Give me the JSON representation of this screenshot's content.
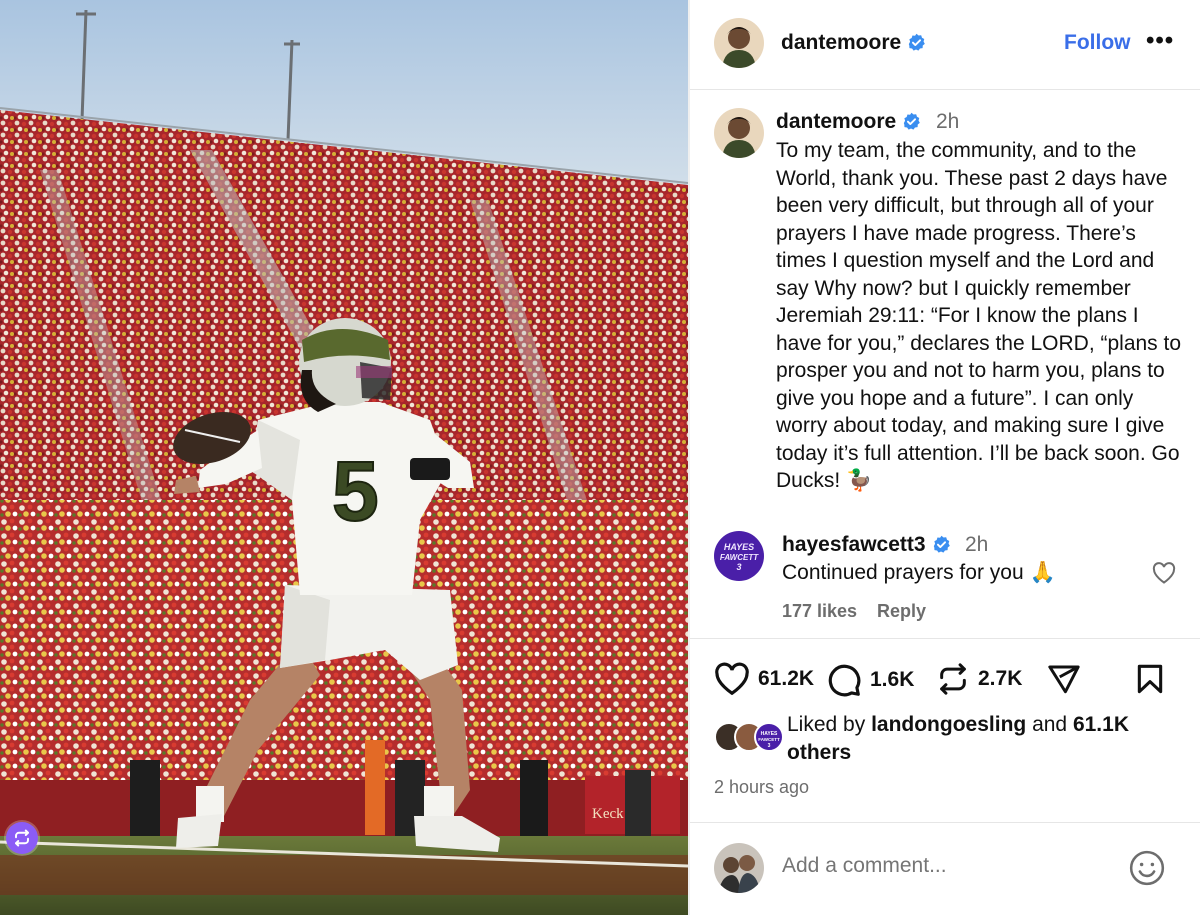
{
  "post": {
    "username": "dantemoore",
    "follow_label": "Follow",
    "more_label": "•••"
  },
  "caption": {
    "username": "dantemoore",
    "time": "2h",
    "text": "To my team, the community, and to the World, thank you. These past 2 days have been very difficult, but through all of your prayers I have made progress. There’s times I question myself and the Lord and say Why now? but I quickly remember Jeremiah 29:11: “For I know the plans I have for you,” declares the LORD, “plans to prosper you and not to harm you, plans to give you hope and a future”. I can only worry about today, and making sure I give today it’s full attention. I’ll be back soon. Go Ducks! 🦆"
  },
  "comment": {
    "username": "hayesfawcett3",
    "avatar_text": "HAYES FAWCETT 3",
    "time": "2h",
    "text": "Continued prayers for you 🙏",
    "likes": "177 likes",
    "reply_label": "Reply"
  },
  "actions": {
    "likes": "61.2K",
    "comments": "1.6K",
    "reposts": "2.7K"
  },
  "liked_by": {
    "prefix": "Liked by ",
    "user": "landongoesling",
    "middle": " and ",
    "count": "61.1K",
    "suffix": "others"
  },
  "time_ago": "2 hours ago",
  "add_comment": {
    "placeholder": "Add a comment..."
  },
  "photo": {
    "jersey_number": "5"
  },
  "colors": {
    "accent": "#3a6ee8",
    "verified": "#3a8ef0",
    "muted": "#6d6d6d",
    "badge": "#8b5cf6"
  }
}
